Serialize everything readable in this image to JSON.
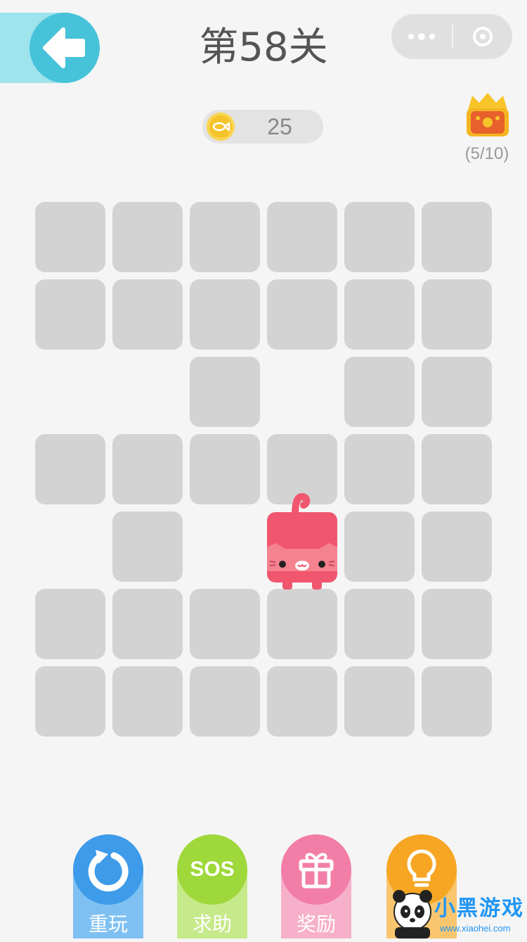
{
  "header": {
    "level_title": "第58关",
    "back_icon": "arrow-left-icon",
    "menu_icon": "more-dots-icon",
    "close_icon": "target-circle-icon"
  },
  "coins": {
    "icon": "fish-coin-icon",
    "value": "25"
  },
  "chest": {
    "icon": "treasure-chest-icon",
    "progress": "(5/10)"
  },
  "board": {
    "rows": 7,
    "cols": 6,
    "cells": [
      [
        1,
        1,
        1,
        1,
        1,
        1
      ],
      [
        1,
        1,
        1,
        1,
        1,
        1
      ],
      [
        0,
        0,
        1,
        0,
        1,
        1
      ],
      [
        1,
        1,
        1,
        1,
        1,
        1
      ],
      [
        0,
        1,
        0,
        2,
        1,
        1
      ],
      [
        1,
        1,
        1,
        1,
        1,
        1
      ],
      [
        1,
        1,
        1,
        1,
        1,
        1
      ]
    ],
    "tile_color": "#d3d3d3",
    "cat_color": "#f0566e"
  },
  "actions": [
    {
      "label": "重玩",
      "icon": "restart-icon",
      "color": "#3d9be9",
      "stem": "#7fc0f3"
    },
    {
      "label": "求助",
      "icon": "sos-icon",
      "icon_text": "SOS",
      "color": "#9fd83a",
      "stem": "#c6e98a"
    },
    {
      "label": "奖励",
      "icon": "gift-icon",
      "color": "#f27ea8",
      "stem": "#f7b0ca"
    },
    {
      "label": "",
      "icon": "lightbulb-icon",
      "color": "#f6a623",
      "stem": "#f9c66f"
    }
  ],
  "watermark": {
    "text": "小黑游戏",
    "url": "www.xiaohei.com"
  }
}
